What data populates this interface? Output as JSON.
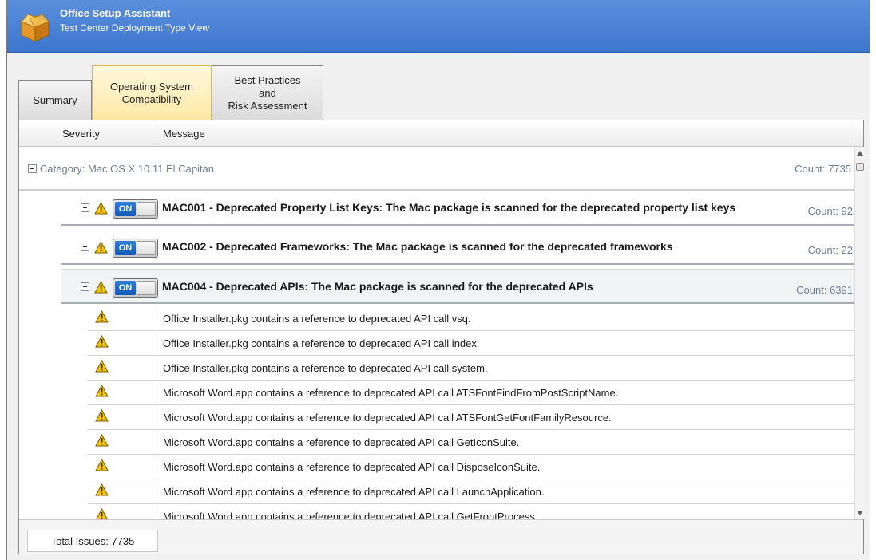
{
  "window": {
    "title": "Office Setup Assistant",
    "subtitle": "Test Center Deployment Type View",
    "app_icon": "package-box-icon"
  },
  "tabs": [
    {
      "label": "Summary",
      "active": false
    },
    {
      "label": "Operating System\nCompatibility",
      "active": true
    },
    {
      "label": "Best Practices\nand\nRisk Assessment",
      "active": false
    }
  ],
  "grid": {
    "columns": [
      "Severity",
      "Message"
    ],
    "category": {
      "label": "Category: Mac OS X 10.11 El Capitan",
      "count": "Count: 7735",
      "expanded": true
    },
    "rules": [
      {
        "text": "MAC001 - Deprecated Property List Keys: The Mac package is scanned for the deprecated property list keys",
        "count": "Count: 92",
        "toggle": "ON",
        "expanded": false
      },
      {
        "text": "MAC002 - Deprecated Frameworks: The Mac package is scanned for the deprecated frameworks",
        "count": "Count: 22",
        "toggle": "ON",
        "expanded": false
      },
      {
        "text": "MAC004 - Deprecated APIs: The Mac package is scanned for the deprecated APIs",
        "count": "Count: 6391",
        "toggle": "ON",
        "expanded": true
      }
    ],
    "issues": [
      "Office Installer.pkg contains a reference to deprecated API call vsq.",
      "Office Installer.pkg contains a reference to deprecated API call index.",
      "Office Installer.pkg contains a reference to deprecated API call system.",
      "Microsoft Word.app contains a reference to deprecated API call ATSFontFindFromPostScriptName.",
      "Microsoft Word.app contains a reference to deprecated API call ATSFontGetFontFamilyResource.",
      "Microsoft Word.app contains a reference to deprecated API call GetIconSuite.",
      "Microsoft Word.app contains a reference to deprecated API call DisposeIconSuite.",
      "Microsoft Word.app contains a reference to deprecated API call LaunchApplication.",
      "Microsoft Word.app contains a reference to deprecated API call GetFrontProcess."
    ]
  },
  "footer": {
    "total": "Total Issues: 7735"
  },
  "colors": {
    "titlebar": "#3e76cf",
    "active_tab": "#fde9a6",
    "toggle_on": "#1f6fcc",
    "warning": "#f5c400"
  }
}
